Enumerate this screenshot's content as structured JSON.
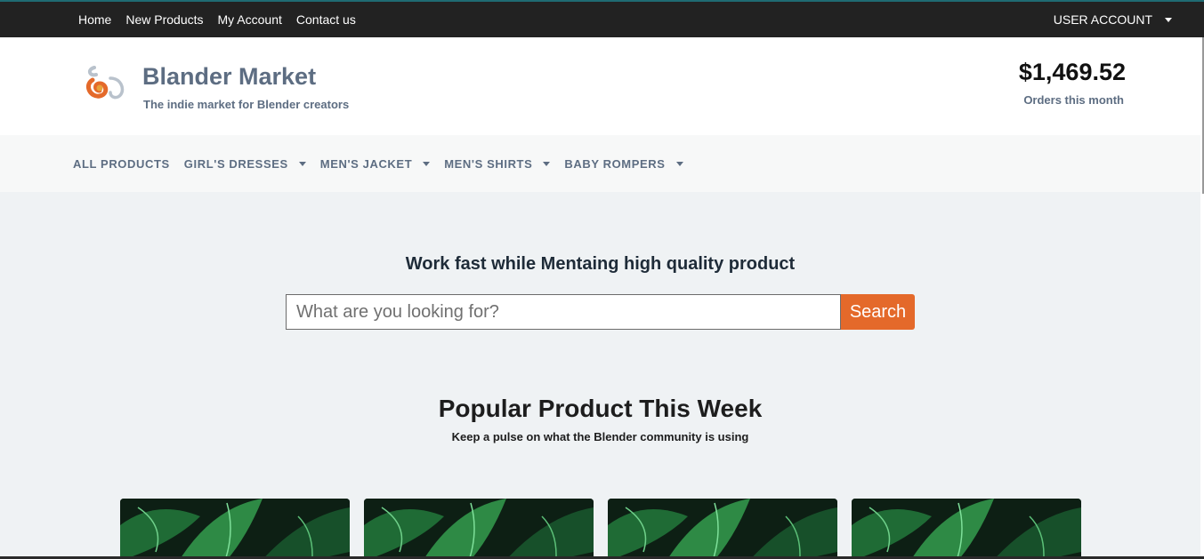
{
  "topnav": {
    "links": [
      "Home",
      "New Products",
      "My Account",
      "Contact us"
    ],
    "account_label": "USER ACCOUNT"
  },
  "header": {
    "brand_name": "Blander Market",
    "tagline": "The indie market for Blender creators",
    "stat_value": "$1,469.52",
    "stat_label": "Orders this month"
  },
  "categories": [
    "ALL PRODUCTS",
    "GIRL'S DRESSES",
    "MEN'S JACKET",
    "MEN'S SHIRTS",
    "BABY ROMPERS"
  ],
  "hero": {
    "title": "Work fast while Mentaing high quality product",
    "search_placeholder": "What are you looking for?",
    "search_button": "Search"
  },
  "popular": {
    "title": "Popular Product This Week",
    "subtitle": "Keep a pulse on what the Blender community is using"
  },
  "colors": {
    "topbar": "#222222",
    "accent": "#e4692a",
    "muted_text": "#5d6d82",
    "page_bg": "#eff2f4"
  },
  "icons": [
    "logo-icon",
    "caret-down-icon"
  ]
}
